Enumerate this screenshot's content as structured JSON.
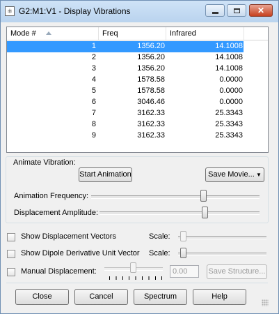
{
  "window": {
    "title": "G2:M1:V1 - Display Vibrations",
    "app_icon": "gaussview-app-icon",
    "controls": {
      "minimize": "minimize-icon",
      "maximize": "maximize-icon",
      "close": "✕"
    }
  },
  "table": {
    "columns": [
      "Mode #",
      "Freq",
      "Infrared"
    ],
    "rows": [
      {
        "mode": "1",
        "freq": "1356.20",
        "ir": "14.1008",
        "selected": true
      },
      {
        "mode": "2",
        "freq": "1356.20",
        "ir": "14.1008"
      },
      {
        "mode": "3",
        "freq": "1356.20",
        "ir": "14.1008"
      },
      {
        "mode": "4",
        "freq": "1578.58",
        "ir": "0.0000"
      },
      {
        "mode": "5",
        "freq": "1578.58",
        "ir": "0.0000"
      },
      {
        "mode": "6",
        "freq": "3046.46",
        "ir": "0.0000"
      },
      {
        "mode": "7",
        "freq": "3162.33",
        "ir": "25.3343"
      },
      {
        "mode": "8",
        "freq": "3162.33",
        "ir": "25.3343"
      },
      {
        "mode": "9",
        "freq": "3162.33",
        "ir": "25.3343"
      }
    ]
  },
  "animate": {
    "group_label": "Animate Vibration:",
    "start_button": "Start Animation",
    "save_movie_button": "Save Movie...",
    "frequency_label": "Animation Frequency:",
    "amplitude_label": "Displacement Amplitude:",
    "frequency_level": 0.67,
    "amplitude_level": 0.66
  },
  "options": {
    "show_vectors_label": "Show Displacement Vectors",
    "show_dipole_label": "Show Dipole Derivative Unit Vector",
    "manual_disp_label": "Manual Displacement:",
    "scale_label": "Scale:",
    "manual_value": "0.00",
    "save_structure_button": "Save Structure..."
  },
  "buttons": {
    "close": "Close",
    "cancel": "Cancel",
    "spectrum": "Spectrum",
    "help": "Help"
  },
  "colors": {
    "selection": "#3399ff",
    "titlebar": "#b9d3ee",
    "close_button": "#c7401f"
  }
}
